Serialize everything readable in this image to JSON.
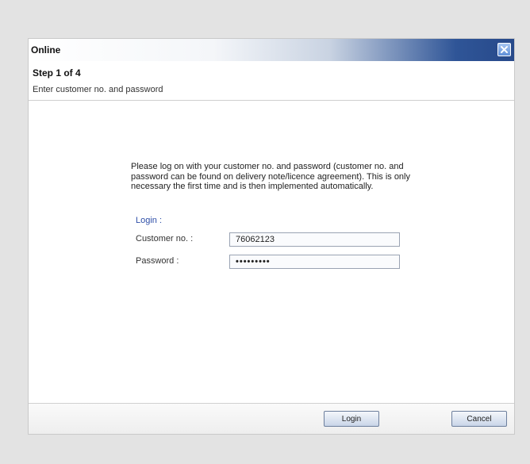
{
  "dialog": {
    "title": "Online",
    "close_icon": "close-icon"
  },
  "step": {
    "title": "Step 1 of 4",
    "subtitle": "Enter customer no. and password"
  },
  "content": {
    "info_text": "Please log on with your customer no. and password (customer no. and password can be found on delivery note/licence agreement). This is only necessary the first time and is then implemented automatically.",
    "login_link": "Login :",
    "customer_label": "Customer no. :",
    "customer_value": "76062123",
    "password_label": "Password :",
    "password_value": "•••••••••"
  },
  "footer": {
    "login_label": "Login",
    "cancel_label": "Cancel"
  },
  "colors": {
    "titlebar_dark": "#27498a",
    "link": "#2f4fa8",
    "background": "#e3e3e3"
  }
}
